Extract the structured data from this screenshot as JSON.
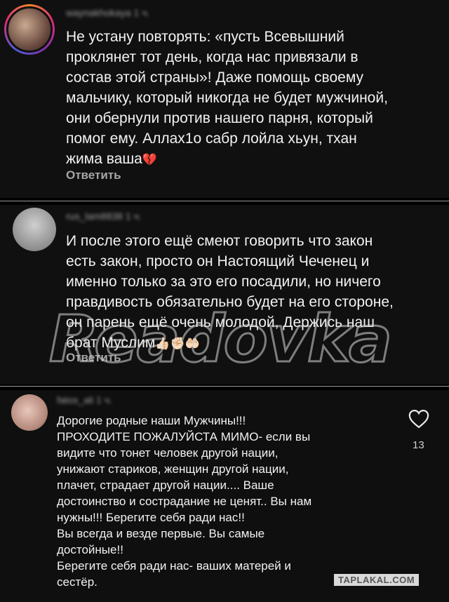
{
  "comments": [
    {
      "username": "waynakhokaya",
      "time": "1 ч.",
      "text": "Не устану повторять: «пусть Всевышний\nпроклянет тот день, когда нас привязали в\nсостав этой страны»! Даже помощь своему\nмальчику, который никогда не будет мужчиной,\nони обернули против нашего парня, который\nпомог ему. Аллах1о сабр лойла хьун, тхан\nжима ваша",
      "emoji": "💔",
      "reply_label": "Ответить"
    },
    {
      "username": "rus_lam8838",
      "time": "1 ч.",
      "text": "И после этого ещё смеют говорить что закон\nесть закон, просто он Настоящий Чеченец и\nименно только за это его посадили, но ничего\nправдивость обязательно будет на его стороне,\nон парень ещё очень молодой, Держись наш\nбрат Муслим",
      "emoji": "👍🏻✊🏻🤲🏻",
      "reply_label": "Ответить"
    },
    {
      "username": "fatos_ali",
      "time": "1 ч.",
      "text": "Дорогие родные наши Мужчины!!!\nПРОХОДИТЕ ПОЖАЛУЙСТА МИМО- если вы\nвидите что тонет человек другой нации,\nунижают стариков, женщин другой нации,\nплачет, страдает другой нации.... Ваше\nдостоинство и сострадание не ценят.. Вы нам\nнужны!!! Берегите себя ради нас!!\nВы всегда и везде первые. Вы самые\nдостойные!!\nБерегите себя ради нас- ваших матерей и\nсестёр.",
      "like_count": "13"
    }
  ],
  "watermark": "Readovka",
  "site_watermark": "TAPLAKAL.COM",
  "icons": {
    "like": "heart-outline-icon"
  }
}
